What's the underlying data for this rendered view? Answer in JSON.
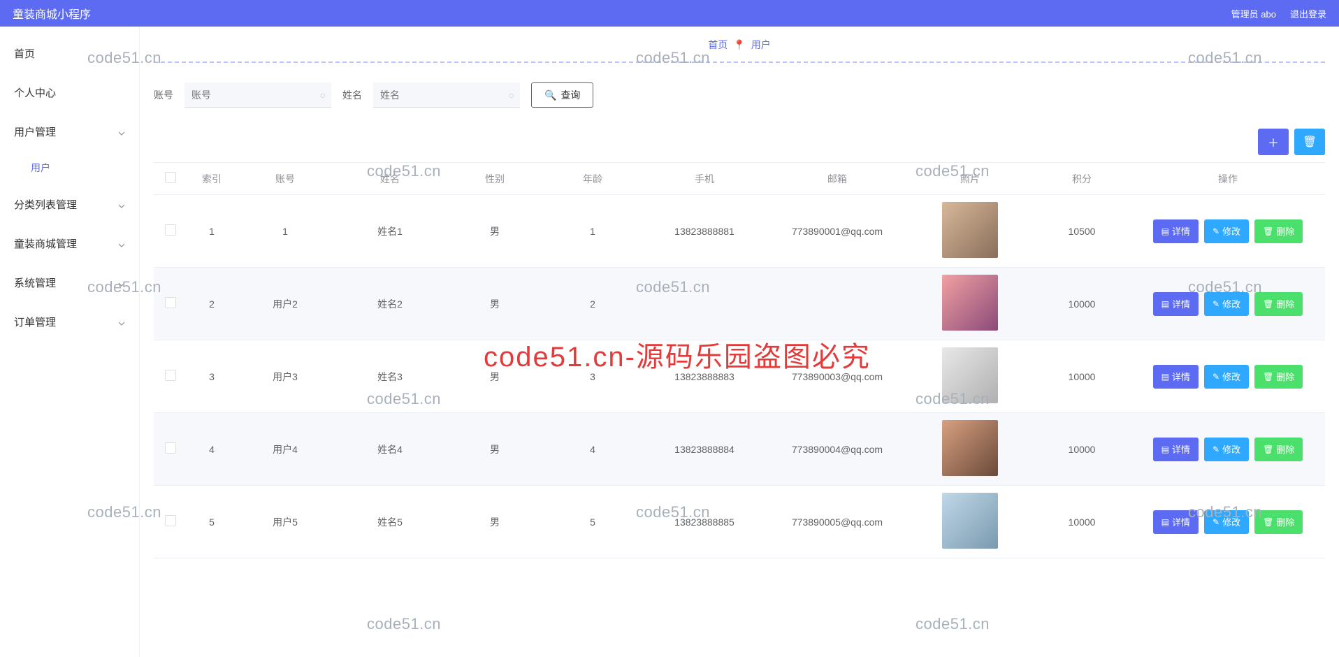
{
  "header": {
    "title": "童装商城小程序",
    "admin_label": "管理员 abo",
    "logout_label": "退出登录"
  },
  "sidebar": {
    "items": [
      {
        "label": "首页",
        "has_children": false
      },
      {
        "label": "个人中心",
        "has_children": false
      },
      {
        "label": "用户管理",
        "has_children": true,
        "children": [
          {
            "label": "用户"
          }
        ]
      },
      {
        "label": "分类列表管理",
        "has_children": true
      },
      {
        "label": "童装商城管理",
        "has_children": true
      },
      {
        "label": "系统管理",
        "has_children": true
      },
      {
        "label": "订单管理",
        "has_children": true
      }
    ]
  },
  "breadcrumb": {
    "home": "首页",
    "icon": "📍",
    "current": "用户"
  },
  "search": {
    "account_label": "账号",
    "account_placeholder": "账号",
    "name_label": "姓名",
    "name_placeholder": "姓名",
    "button_label": "查询"
  },
  "actions": {
    "add_icon": "＋",
    "batch_delete_icon": "🗑"
  },
  "table": {
    "headers": {
      "index": "索引",
      "account": "账号",
      "name": "姓名",
      "gender": "性别",
      "age": "年龄",
      "phone": "手机",
      "email": "邮箱",
      "photo": "照片",
      "points": "积分",
      "ops": "操作"
    },
    "ops": {
      "detail": "详情",
      "edit": "修改",
      "delete": "删除"
    },
    "rows": [
      {
        "index": "1",
        "account": "1",
        "name": "姓名1",
        "gender": "男",
        "age": "1",
        "phone": "13823888881",
        "email": "773890001@qq.com",
        "points": "10500"
      },
      {
        "index": "2",
        "account": "用户2",
        "name": "姓名2",
        "gender": "男",
        "age": "2",
        "phone": "",
        "email": "",
        "points": "10000"
      },
      {
        "index": "3",
        "account": "用户3",
        "name": "姓名3",
        "gender": "男",
        "age": "3",
        "phone": "13823888883",
        "email": "773890003@qq.com",
        "points": "10000"
      },
      {
        "index": "4",
        "account": "用户4",
        "name": "姓名4",
        "gender": "男",
        "age": "4",
        "phone": "13823888884",
        "email": "773890004@qq.com",
        "points": "10000"
      },
      {
        "index": "5",
        "account": "用户5",
        "name": "姓名5",
        "gender": "男",
        "age": "5",
        "phone": "13823888885",
        "email": "773890005@qq.com",
        "points": "10000"
      }
    ]
  },
  "watermark": {
    "text": "code51.cn",
    "main_text": "code51.cn-源码乐园盗图必究"
  }
}
